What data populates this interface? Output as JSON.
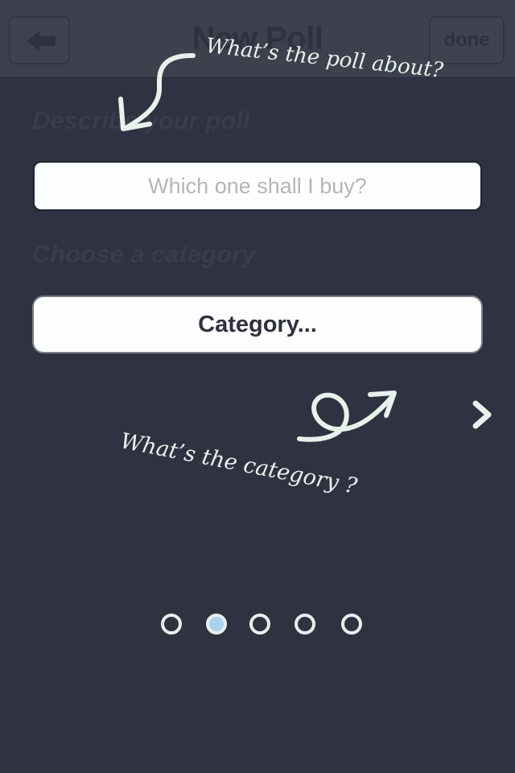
{
  "nav": {
    "title": "New Poll",
    "back_icon": "back-arrow-icon",
    "done_label": "done"
  },
  "form": {
    "describe_label": "Describe your poll",
    "poll_placeholder": "Which one shall I buy?",
    "poll_value": "",
    "category_label": "Choose a category",
    "category_button": "Category..."
  },
  "annotations": {
    "top_hint": "What’s the poll about?",
    "category_hint": "What’s the category ?"
  },
  "pager": {
    "total": 5,
    "current": 2,
    "next_icon": "chevron-right-icon"
  },
  "colors": {
    "background": "#2f3241",
    "navbar": "#3d404d",
    "annotation": "#e8f2ea",
    "active_dot": "#a8d4f2"
  }
}
